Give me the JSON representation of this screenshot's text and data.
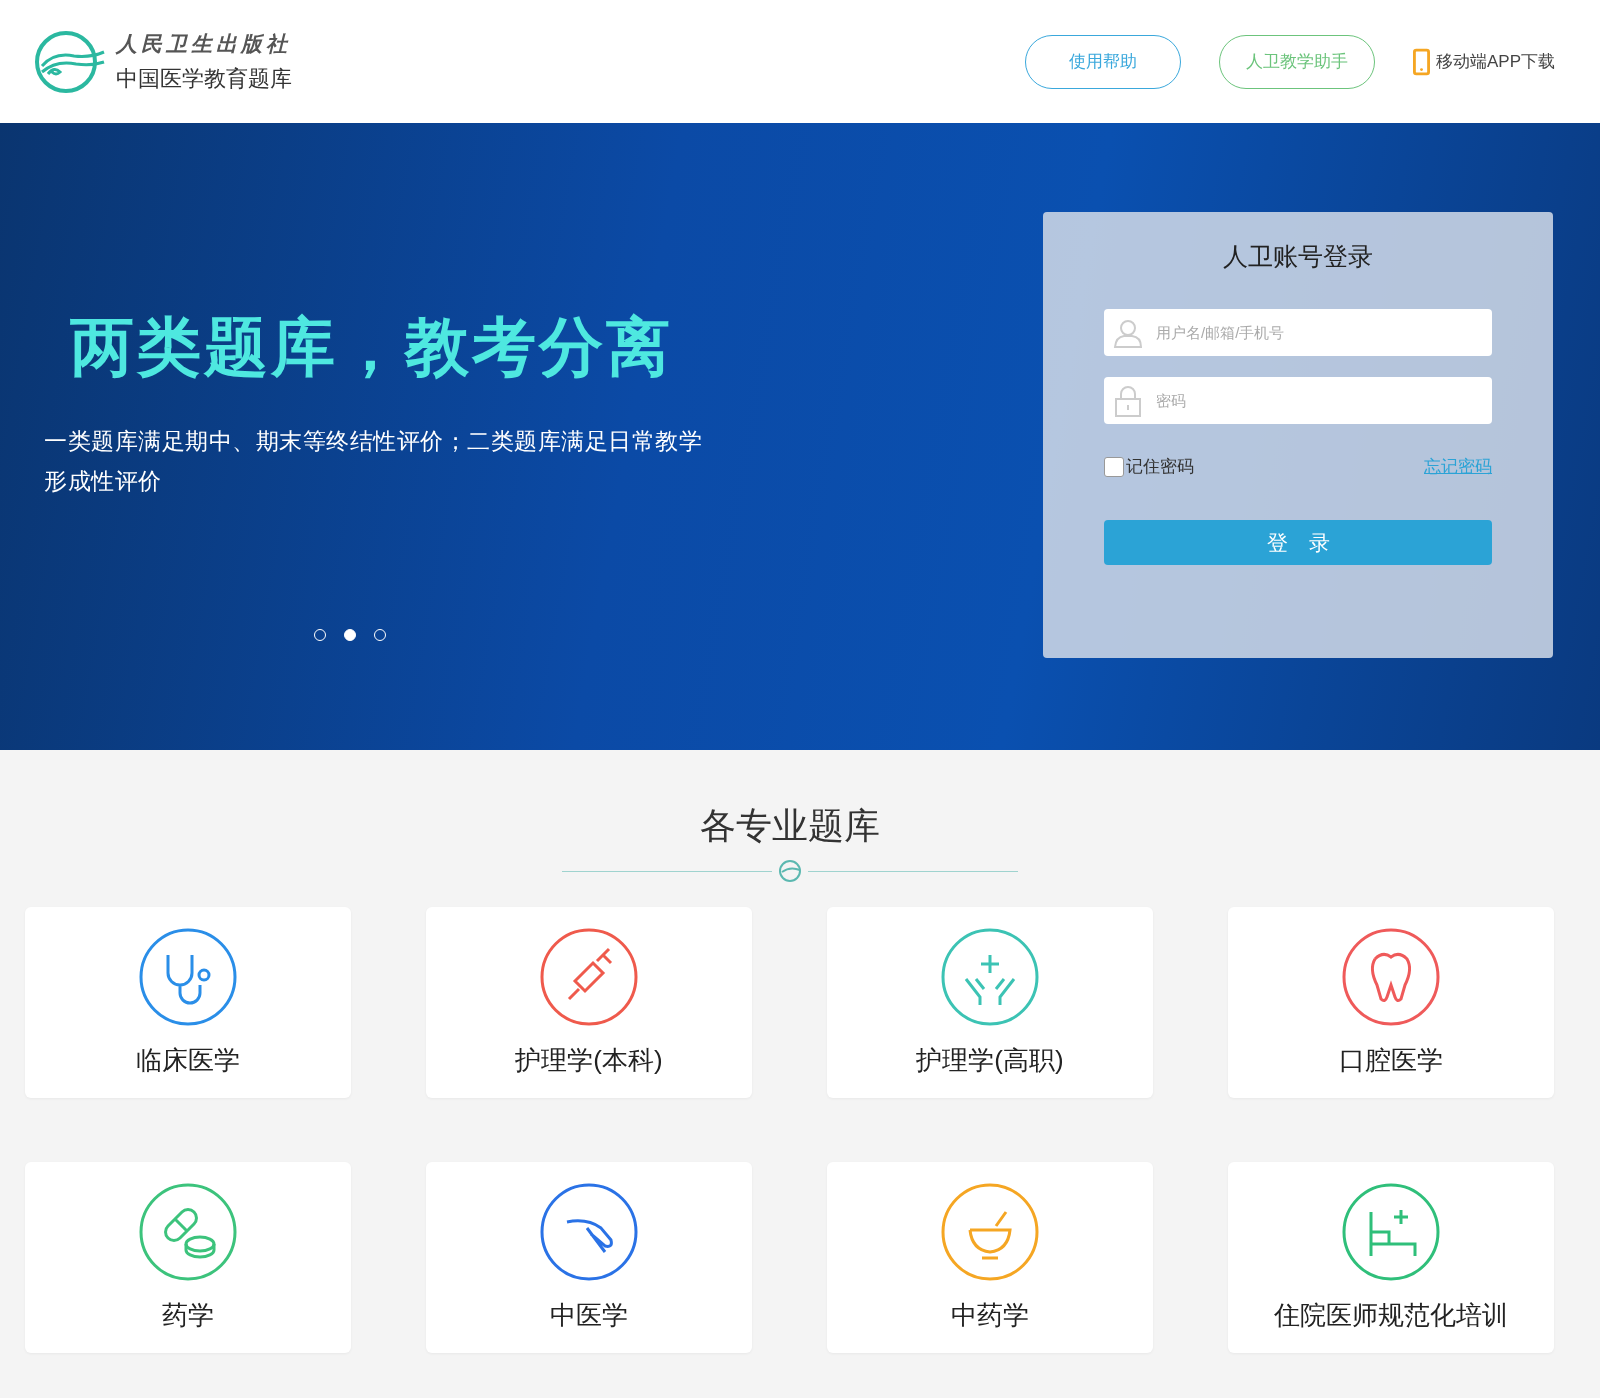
{
  "header": {
    "publisher": "人民卫生出版社",
    "site_name": "中国医学教育题库",
    "buttons": [
      {
        "label": "使用帮助",
        "color": "#3aa8dc"
      },
      {
        "label": "人卫教学助手",
        "color": "#6cc47c"
      }
    ],
    "app_link": "移动端APP下载"
  },
  "banner": {
    "headline": "两类题库，教考分离",
    "description": "一类题库满足期中、期末等终结性评价；二类题库满足日常教学形成性评价",
    "dots": [
      {
        "selected": false
      },
      {
        "selected": true
      },
      {
        "selected": false
      }
    ]
  },
  "login": {
    "title": "人卫账号登录",
    "username": {
      "placeholder": "用户名/邮箱/手机号"
    },
    "password": {
      "placeholder": "密码"
    },
    "remember": {
      "label": "记住密码",
      "checked": false
    },
    "forgot_link": "忘记密码",
    "submit": "登　录"
  },
  "section": {
    "title": "各专业题库",
    "cards": [
      {
        "label": "临床医学",
        "color": "#2a8ee8"
      },
      {
        "label": "护理学(本科)",
        "color": "#ef5a4c"
      },
      {
        "label": "护理学(高职)",
        "color": "#3cc3b4"
      },
      {
        "label": "口腔医学",
        "color": "#ef5a5a"
      },
      {
        "label": "药学",
        "color": "#3cc37c"
      },
      {
        "label": "中医学",
        "color": "#2a72e6"
      },
      {
        "label": "中药学",
        "color": "#f5a623"
      },
      {
        "label": "住院医师规范化培训",
        "color": "#2fbf7a"
      }
    ]
  }
}
